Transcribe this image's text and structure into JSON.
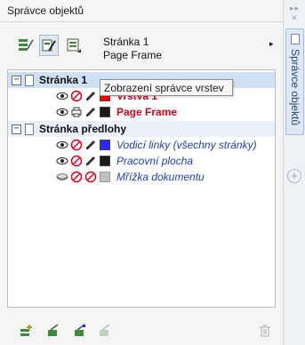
{
  "panel": {
    "title": "Správce objektů"
  },
  "toolbar": {
    "page_name": "Stránka 1",
    "layer_name": "Page Frame",
    "arrow": "▸"
  },
  "tree": {
    "group1": {
      "label": "Stránka 1",
      "expander": "−",
      "layers": [
        {
          "label": "Vrstva 1",
          "color": "#ff0000"
        },
        {
          "label": "Page Frame",
          "color": "#1a1a1a"
        }
      ]
    },
    "group2": {
      "label": "Stránka předlohy",
      "expander": "−",
      "layers": [
        {
          "label": "Vodicí linky (všechny stránky)",
          "color": "#2a2aff"
        },
        {
          "label": "Pracovní plocha",
          "color": "#1a1a1a"
        },
        {
          "label": "Mřížka dokumentu",
          "color": "#c0c0c0"
        }
      ]
    }
  },
  "tooltip": {
    "text": "Zobrazení správce vrstev"
  },
  "side": {
    "tab_label": "Správce objektů",
    "controls": "▸▸ ✕",
    "add": "+"
  }
}
